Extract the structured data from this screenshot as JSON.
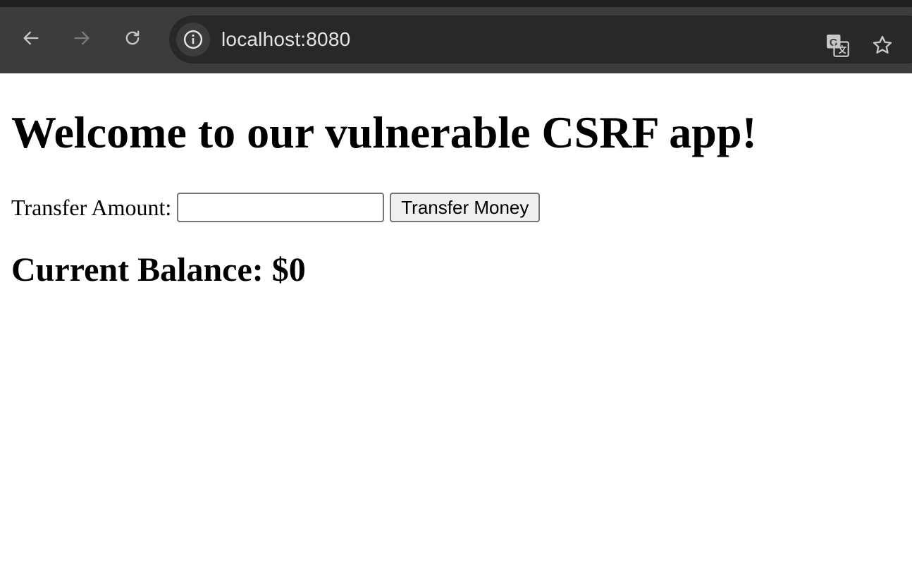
{
  "browser": {
    "url": "localhost:8080",
    "icons": {
      "back": "back-arrow-icon",
      "forward": "forward-arrow-icon",
      "reload": "reload-icon",
      "site_info": "info-icon",
      "translate": "translate-icon",
      "bookmark": "star-icon"
    },
    "forward_enabled": false
  },
  "page": {
    "heading": "Welcome to our vulnerable CSRF app!",
    "form": {
      "label": "Transfer Amount:",
      "input_value": "",
      "button_label": "Transfer Money"
    },
    "balance_text": "Current Balance: $0"
  },
  "colors": {
    "chrome_bg": "#3c3c3c",
    "omnibox_bg": "#282828",
    "url_text": "#e3e3e3"
  }
}
